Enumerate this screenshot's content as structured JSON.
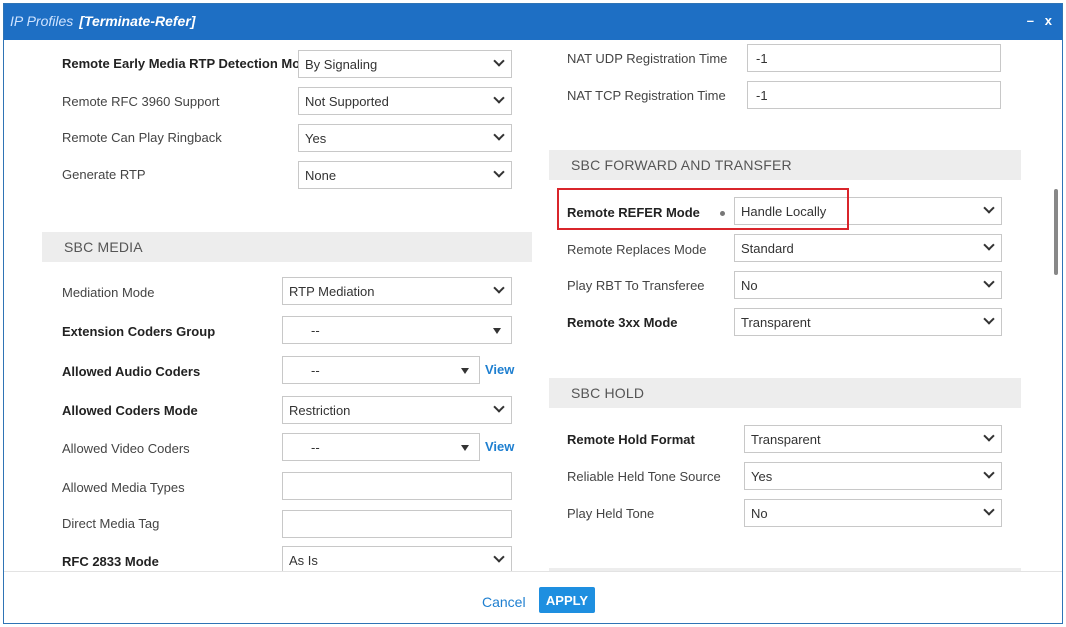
{
  "window": {
    "title_prefix": "IP Profiles",
    "title_name": "[Terminate-Refer]",
    "minimize": "–",
    "close": "x"
  },
  "left": {
    "rows1": [
      {
        "label": "Remote Early Media RTP Detection Mode",
        "value": "By Signaling"
      },
      {
        "label": "Remote RFC 3960 Support",
        "value": "Not Supported"
      },
      {
        "label": "Remote Can Play Ringback",
        "value": "Yes"
      },
      {
        "label": "Generate RTP",
        "value": "None"
      }
    ],
    "media_section": "SBC MEDIA",
    "media_rows": [
      {
        "label": "Mediation Mode",
        "value": "RTP Mediation"
      },
      {
        "label": "Extension Coders Group",
        "value": "--"
      },
      {
        "label": "Allowed Audio Coders",
        "value": "--",
        "link": "View"
      },
      {
        "label": "Allowed Coders Mode",
        "value": "Restriction"
      },
      {
        "label": "Allowed Video Coders",
        "value": "--",
        "link": "View"
      },
      {
        "label": "Allowed Media Types",
        "value": ""
      },
      {
        "label": "Direct Media Tag",
        "value": ""
      },
      {
        "label": "RFC 2833 Mode",
        "value": "As Is"
      }
    ]
  },
  "right": {
    "nat_rows": [
      {
        "label": "NAT UDP Registration Time",
        "value": "-1"
      },
      {
        "label": "NAT TCP Registration Time",
        "value": "-1"
      }
    ],
    "forward_section": "SBC FORWARD AND TRANSFER",
    "forward_rows": [
      {
        "label": "Remote REFER Mode",
        "value": "Handle Locally"
      },
      {
        "label": "Remote Replaces Mode",
        "value": "Standard"
      },
      {
        "label": "Play RBT To Transferee",
        "value": "No"
      },
      {
        "label": "Remote 3xx Mode",
        "value": "Transparent"
      }
    ],
    "hold_section": "SBC HOLD",
    "hold_rows": [
      {
        "label": "Remote Hold Format",
        "value": "Transparent"
      },
      {
        "label": "Reliable Held Tone Source",
        "value": "Yes"
      },
      {
        "label": "Play Held Tone",
        "value": "No"
      }
    ]
  },
  "footer": {
    "cancel": "Cancel",
    "apply": "APPLY"
  },
  "colors": {
    "titlebar": "#1e6fc4",
    "highlight": "#d9252b",
    "apply": "#1e8fe0",
    "link": "#1e7fd0"
  }
}
